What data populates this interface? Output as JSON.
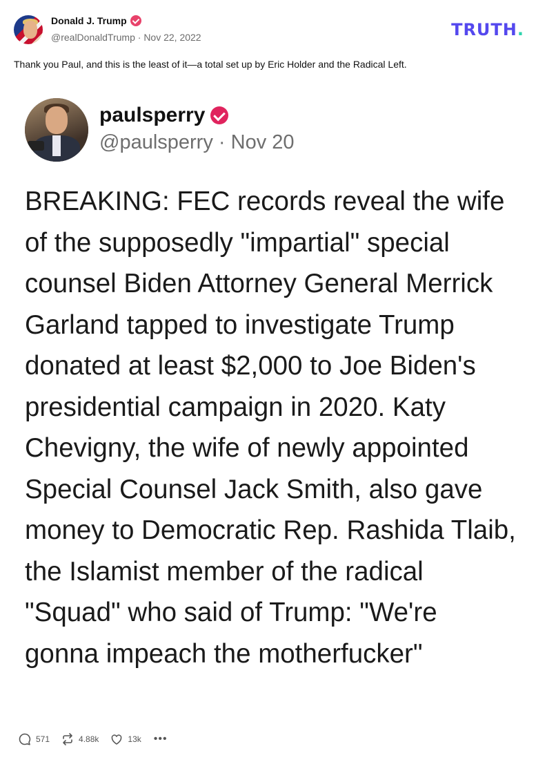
{
  "post": {
    "author_name": "Donald J. Trump",
    "author_handle": "@realDonaldTrump",
    "separator": "·",
    "date": "Nov 22, 2022",
    "caption": "Thank you Paul, and this is the least of it—a total set up by Eric Holder and the Radical Left."
  },
  "brand": {
    "logo_text": "TRUTH",
    "logo_dot": ".",
    "accent_color": "#5448ee",
    "dot_color": "#2fd4ae"
  },
  "embedded": {
    "name": "paulsperry",
    "handle": "@paulsperry",
    "separator": "·",
    "date": "Nov 20",
    "text": "BREAKING: FEC records reveal the wife of the supposedly \"impartial\" special counsel Biden Attorney General Merrick Garland tapped to investigate Trump donated at least $2,000 to Joe Biden's presidential campaign in 2020. Katy Chevigny, the wife of newly appointed Special Counsel Jack Smith, also gave money to Democratic Rep. Rashida Tlaib, the Islamist member of the radical \"Squad\" who said of Trump: \"We're gonna impeach the motherfucker\"",
    "verified_color": "#e0245e"
  },
  "actions": {
    "replies": "571",
    "retruths": "4.88k",
    "likes": "13k",
    "more": "•••"
  },
  "icons": [
    "verified-badge-icon",
    "reply-icon",
    "retruth-icon",
    "heart-icon",
    "more-icon"
  ]
}
